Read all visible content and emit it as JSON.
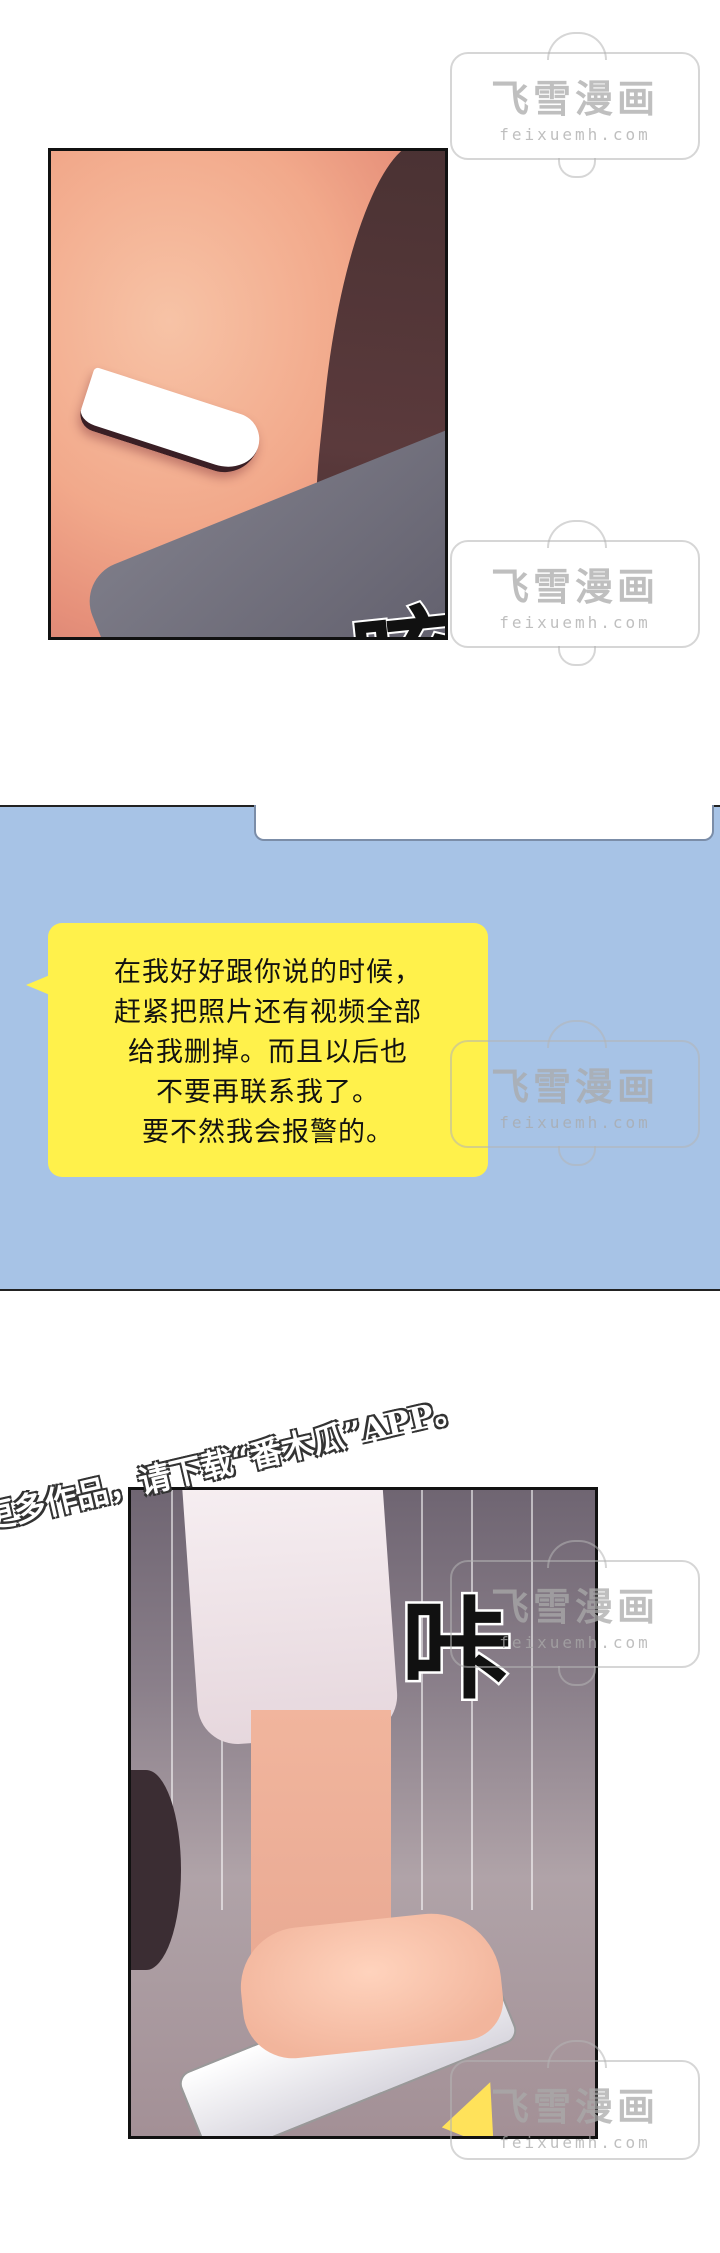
{
  "watermark": {
    "title": "飞雪漫画",
    "domain": "feixuemh.com"
  },
  "panel1": {
    "sfx": "咳"
  },
  "chat": {
    "message_lines": [
      "在我好好跟你说的时候，",
      "赶紧把照片还有视频全部",
      "给我删掉。而且以后也",
      "不要再联系我了。",
      "要不然我会报警的。"
    ]
  },
  "panel3": {
    "sfx": "咔",
    "promo_text": "更多作品，请下载“番木瓜”APP。"
  },
  "colors": {
    "chat_background": "#a7c3e6",
    "bubble_yellow": "#fff14b"
  }
}
